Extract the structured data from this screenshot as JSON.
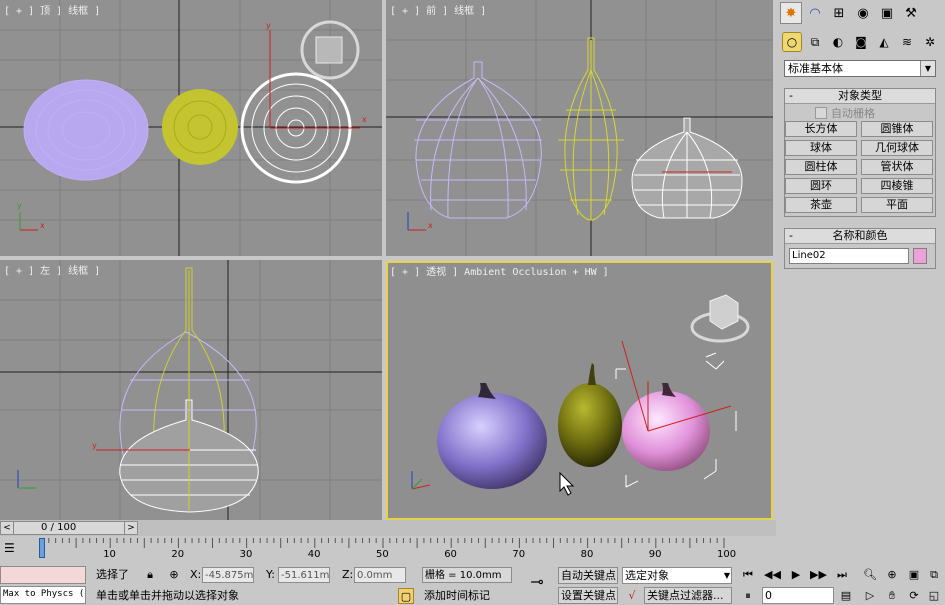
{
  "viewports": {
    "top": {
      "label": "[ + ] 顶 ] 线框 ]"
    },
    "front": {
      "label": "[ + ] 前 ] 线框 ]"
    },
    "left": {
      "label": "[ + ] 左 ] 线框 ]"
    },
    "perspective": {
      "label": "[ + ] 透视 ] Ambient Occlusion + HW ]"
    }
  },
  "command_panel": {
    "tabs": [
      "create-icon",
      "modify-icon",
      "hierarchy-icon",
      "motion-icon",
      "display-icon",
      "utilities-icon"
    ],
    "subtabs": [
      "geometry-icon",
      "shapes-icon",
      "lights-icon",
      "cameras-icon",
      "helpers-icon",
      "spacewarps-icon",
      "systems-icon"
    ],
    "category": "标准基本体",
    "object_type": {
      "title": "对象类型",
      "autogrid": "自动栅格",
      "buttons": [
        "长方体",
        "圆锥体",
        "球体",
        "几何球体",
        "圆柱体",
        "管状体",
        "圆环",
        "四棱锥",
        "茶壶",
        "平面"
      ]
    },
    "name_color": {
      "title": "名称和颜色",
      "name": "Line02",
      "color": "#f0a0d8"
    }
  },
  "timeline": {
    "frame": "0 / 100",
    "ticks": [
      "10",
      "20",
      "30",
      "40",
      "50",
      "60",
      "70",
      "80",
      "90",
      "100"
    ]
  },
  "status": {
    "script_label": "Max to Physcs (",
    "selected": "选择了",
    "x_label": "X:",
    "x_value": "-45.875mm",
    "y_label": "Y:",
    "y_value": "-51.611mm",
    "z_label": "Z:",
    "z_value": "0.0mm",
    "grid": "栅格 = 10.0mm",
    "auto_key": "自动关键点",
    "set_key": "设置关键点",
    "selection": "选定对象",
    "key_filters": "关键点过滤器...",
    "prompt": "单击或单击并拖动以选择对象",
    "add_time_tag": "添加时间标记",
    "frame_value": "0"
  },
  "colors": {
    "viewport_bg": "#919191",
    "active_border": "#e8d24a",
    "purple_object": "#b9a6f0",
    "olive_object": "#c8c832",
    "white_object": "#ffffff"
  }
}
